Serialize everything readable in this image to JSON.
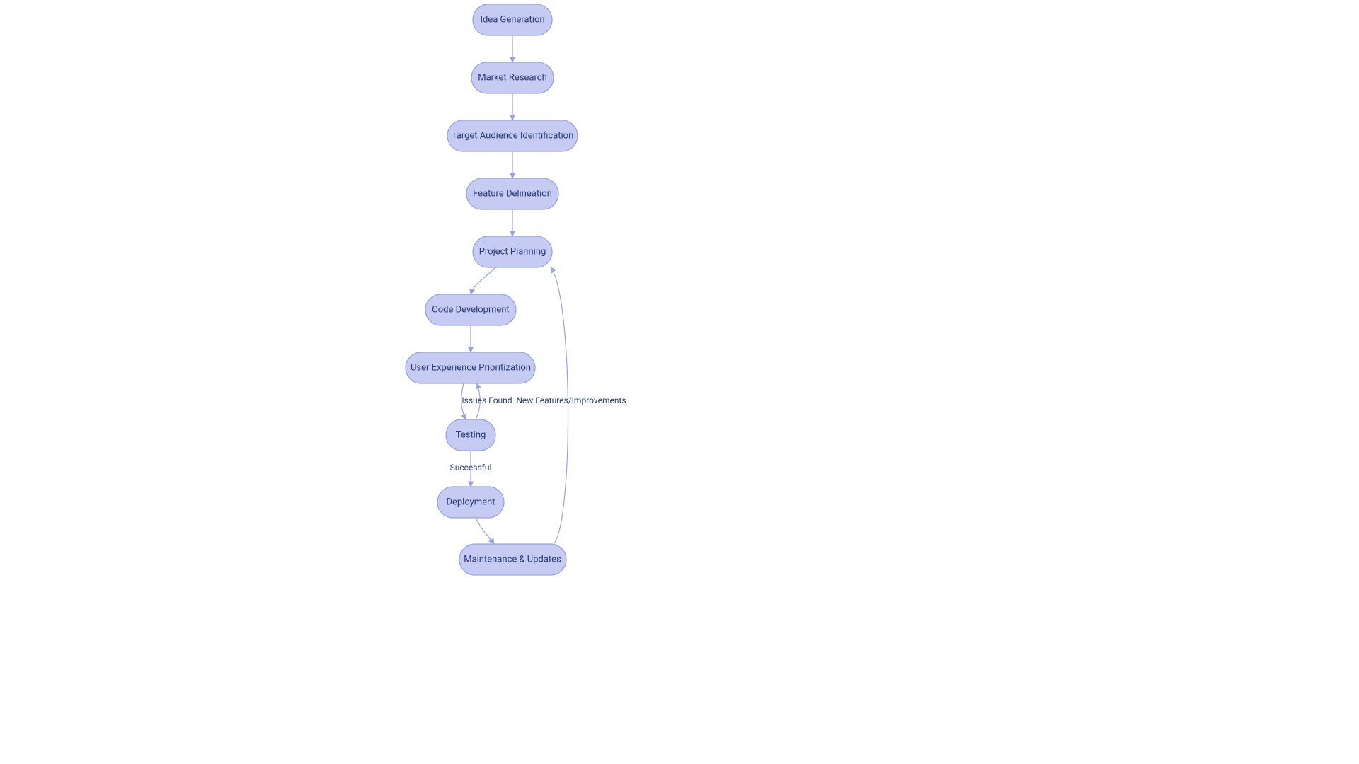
{
  "diagram": {
    "type": "flowchart",
    "nodes": {
      "idea": {
        "label": "Idea Generation"
      },
      "market": {
        "label": "Market Research"
      },
      "audience": {
        "label": "Target Audience Identification"
      },
      "feature": {
        "label": "Feature Delineation"
      },
      "planning": {
        "label": "Project Planning"
      },
      "code": {
        "label": "Code Development"
      },
      "ux": {
        "label": "User Experience Prioritization"
      },
      "testing": {
        "label": "Testing"
      },
      "deployment": {
        "label": "Deployment"
      },
      "maintenance": {
        "label": "Maintenance & Updates"
      }
    },
    "edges": {
      "idea_to_market": {
        "label": ""
      },
      "market_to_audience": {
        "label": ""
      },
      "audience_to_feature": {
        "label": ""
      },
      "feature_to_planning": {
        "label": ""
      },
      "planning_to_code": {
        "label": ""
      },
      "code_to_ux": {
        "label": ""
      },
      "ux_to_testing": {
        "label": ""
      },
      "testing_to_ux": {
        "label": "Issues Found"
      },
      "testing_to_deployment": {
        "label": "Successful"
      },
      "deployment_to_maintenance": {
        "label": ""
      },
      "maintenance_to_planning": {
        "label": "New Features/Improvements"
      }
    },
    "colors": {
      "node_fill": "#c5cbf2",
      "node_stroke": "#9aa3e0",
      "edge_stroke": "#9aa3e0",
      "text": "#2a3a7a"
    }
  }
}
